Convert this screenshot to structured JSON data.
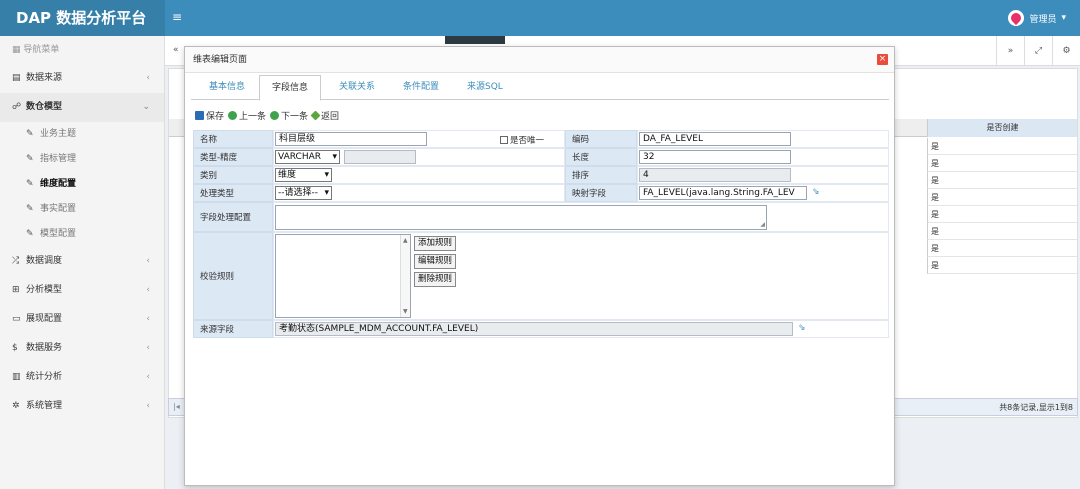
{
  "app": {
    "brand": "DAP 数据分析平台",
    "user": "管理员"
  },
  "sidebar": {
    "header": "导航菜单",
    "items": [
      {
        "label": "数据来源",
        "icon": "database-icon"
      },
      {
        "label": "数仓模型",
        "icon": "sitemap-icon",
        "open": true
      },
      {
        "label": "数据调度",
        "icon": "shuffle-icon"
      },
      {
        "label": "分析模型",
        "icon": "structure-icon"
      },
      {
        "label": "展现配置",
        "icon": "layout-icon"
      },
      {
        "label": "数据服务",
        "icon": "dollar-icon"
      },
      {
        "label": "统计分析",
        "icon": "bar-chart-icon"
      },
      {
        "label": "系统管理",
        "icon": "gear-icon"
      }
    ],
    "subitems": [
      {
        "label": "业务主题"
      },
      {
        "label": "指标管理"
      },
      {
        "label": "维度配置",
        "active": true
      },
      {
        "label": "事实配置"
      },
      {
        "label": "模型配置"
      }
    ]
  },
  "background": {
    "column_header": "是否创建",
    "rows": [
      "是",
      "是",
      "是",
      "是",
      "是",
      "是",
      "是",
      "是"
    ],
    "footer_info": "共8条记录,显示1到8"
  },
  "dialog": {
    "title": "维表编辑页面",
    "tabs": [
      "基本信息",
      "字段信息",
      "关联关系",
      "条件配置",
      "来源SQL"
    ],
    "active_tab": 1,
    "toolbar": {
      "save": "保存",
      "prev": "上一条",
      "next": "下一条",
      "back": "返回"
    },
    "form": {
      "name_label": "名称",
      "name_value": "科目层级",
      "unique_label": "是否唯一",
      "code_label": "编码",
      "code_value": "DA_FA_LEVEL",
      "type_label": "类型-精度",
      "type_value": "VARCHAR",
      "precision_value": "",
      "length_label": "长度",
      "length_value": "32",
      "category_label": "类别",
      "category_value": "维度",
      "order_label": "排序",
      "order_value": "4",
      "process_label": "处理类型",
      "process_value": "--请选择--",
      "mapping_label": "映射字段",
      "mapping_value": "FA_LEVEL(java.lang.String.FA_LEV",
      "process_config_label": "字段处理配置",
      "validation_label": "校验规则",
      "add_rule": "添加规则",
      "edit_rule": "编辑规则",
      "delete_rule": "删除规则",
      "source_label": "来源字段",
      "source_value": "考勤状态(SAMPLE_MDM_ACCOUNT.FA_LEVEL)"
    }
  }
}
